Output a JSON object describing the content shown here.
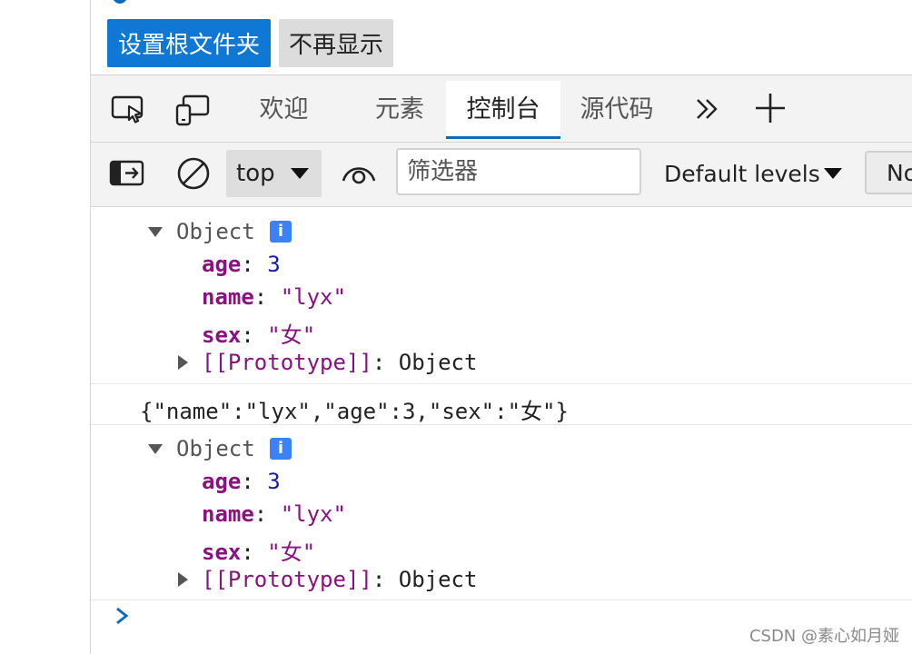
{
  "notification": {
    "set_root_folder_label": "设置根文件夹",
    "dont_show_again_label": "不再显示"
  },
  "tabs": [
    {
      "label": "欢迎",
      "active": false
    },
    {
      "label": "元素",
      "active": false
    },
    {
      "label": "控制台",
      "active": true
    },
    {
      "label": "源代码",
      "active": false
    }
  ],
  "toolbar": {
    "context_value": "top",
    "filter_placeholder": "筛选器",
    "levels_label": "Default levels",
    "issues_label": "No"
  },
  "console": {
    "entries": [
      {
        "type": "object",
        "label": "Object",
        "properties": [
          {
            "key": "age",
            "value": "3"
          },
          {
            "key": "name",
            "value": "\"lyx\""
          },
          {
            "key": "sex",
            "value": "\"女\""
          }
        ],
        "prototype": "[[Prototype]]",
        "prototype_value": "Object"
      },
      {
        "type": "text",
        "text": "{\"name\":\"lyx\",\"age\":3,\"sex\":\"女\"}"
      },
      {
        "type": "object",
        "label": "Object",
        "properties": [
          {
            "key": "age",
            "value": "3"
          },
          {
            "key": "name",
            "value": "\"lyx\""
          },
          {
            "key": "sex",
            "value": "\"女\""
          }
        ],
        "prototype": "[[Prototype]]",
        "prototype_value": "Object"
      }
    ]
  },
  "watermark": "CSDN @素心如月娅",
  "colors": {
    "accent": "#0f6cbd",
    "primary_button": "#0f78d4",
    "info_badge": "#3b82f6",
    "key_color": "#881280",
    "number_color": "#1a1aa6"
  }
}
